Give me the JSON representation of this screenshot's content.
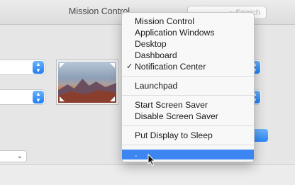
{
  "window": {
    "title": "Mission Control",
    "search_placeholder": "Search"
  },
  "menu": {
    "items_group1": [
      {
        "label": "Mission Control",
        "checked": false
      },
      {
        "label": "Application Windows",
        "checked": false
      },
      {
        "label": "Desktop",
        "checked": false
      },
      {
        "label": "Dashboard",
        "checked": false
      },
      {
        "label": "Notification Center",
        "checked": true
      }
    ],
    "checkmark": "✓",
    "items_group2": [
      {
        "label": "Launchpad"
      }
    ],
    "items_group3": [
      {
        "label": "Start Screen Saver"
      },
      {
        "label": "Disable Screen Saver"
      }
    ],
    "items_group4": [
      {
        "label": "Put Display to Sleep"
      }
    ],
    "selected_item": {
      "label": "-"
    }
  },
  "icons": {
    "search": "search-icon",
    "stepper": "chevron-updown-icon",
    "cursor": "mouse-pointer-icon"
  },
  "colors": {
    "accent": "#3d86f2",
    "menu_bg": "#f8f8f8"
  }
}
